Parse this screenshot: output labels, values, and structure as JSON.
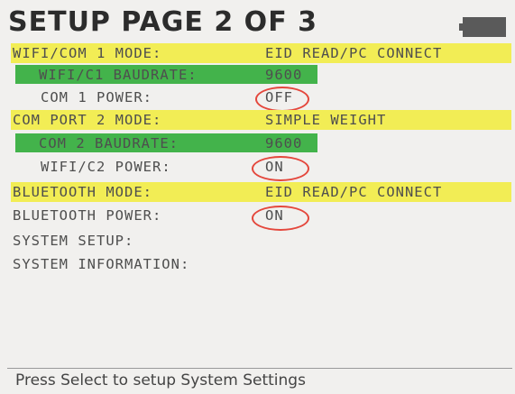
{
  "header": {
    "title": "SETUP PAGE 2 OF 3",
    "battery_icon": "battery-icon"
  },
  "settings": [
    {
      "label": "WIFI/COM 1 MODE:",
      "value": "EID READ/PC CONNECT"
    },
    {
      "label": "WIFI/C1 BAUDRATE:",
      "value": "9600"
    },
    {
      "label": "COM 1 POWER:",
      "value": "OFF"
    },
    {
      "label": "COM PORT 2 MODE:",
      "value": "SIMPLE WEIGHT"
    },
    {
      "label": "COM 2 BAUDRATE:",
      "value": "9600"
    },
    {
      "label": "WIFI/C2 POWER:",
      "value": "ON"
    },
    {
      "label": "BLUETOOTH MODE:",
      "value": "EID READ/PC CONNECT"
    },
    {
      "label": "BLUETOOTH POWER:",
      "value": "ON"
    },
    {
      "label": "SYSTEM SETUP:"
    },
    {
      "label": "SYSTEM INFORMATION:"
    }
  ],
  "status_bar": {
    "text": "Press Select to setup System Settings"
  },
  "colors": {
    "yellow_highlight": "#f2ed55",
    "green_highlight": "#43b34b",
    "circle": "#e4473c"
  }
}
